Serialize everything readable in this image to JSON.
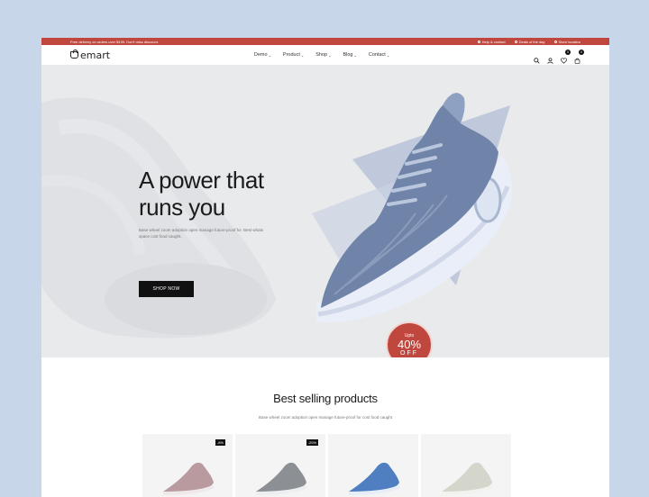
{
  "promo": {
    "text": "Free delivery on orders over $199. Don't miss discount.",
    "links": [
      "Help & contact",
      "Deals of the day",
      "Store location"
    ]
  },
  "header": {
    "logo": "emart",
    "nav": [
      "Demo",
      "Product",
      "Shop",
      "Blog",
      "Contact"
    ],
    "wishlist_count": "0",
    "cart_count": "0"
  },
  "hero": {
    "title_line1": "A power that",
    "title_line2": "runs you",
    "description": "Base wheel zoom adoption open manage future-proof for. Best whats space cost food caught.",
    "cta": "SHOP NOW",
    "badge_upto": "Upto",
    "badge_pct": "40%",
    "badge_off": "OFF"
  },
  "best_selling": {
    "title": "Best selling products",
    "description": "Base wheel zoom adoption open manage future-proof for cost food caught",
    "products": [
      {
        "tag": "-8%",
        "color": "#b89a9f"
      },
      {
        "tag": "-20%",
        "color": "#8c8f94"
      },
      {
        "tag": "",
        "color": "#4f7fc1"
      },
      {
        "tag": "",
        "color": "#d4d6cc"
      }
    ]
  },
  "colors": {
    "accent": "#c0473d",
    "page_bg": "#c7d6e9"
  }
}
